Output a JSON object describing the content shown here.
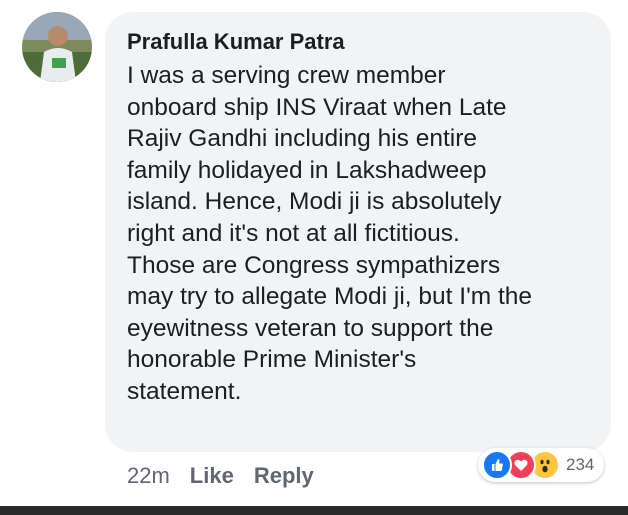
{
  "comment": {
    "author": "Prafulla Kumar Patra",
    "text": "I was a serving crew member\nonboard ship INS Viraat when Late\nRajiv Gandhi including his entire\nfamily holidayed in Lakshadweep\nisland.  Hence, Modi ji is absolutely\nright and it's not at all fictitious.\nThose are Congress sympathizers\nmay try to allegate Modi ji, but I'm the\neyewitness veteran to support the\nhonorable Prime Minister's\nstatement."
  },
  "actions": {
    "time": "22m",
    "like_label": "Like",
    "reply_label": "Reply"
  },
  "reactions": {
    "icons": [
      "like-icon",
      "love-icon",
      "wow-icon"
    ],
    "count": "234"
  },
  "colors": {
    "bubble_bg": "#f2f3f5",
    "like": "#1877f2",
    "love": "#f33e58",
    "wow": "#fcc63f",
    "meta_text": "#606770"
  }
}
